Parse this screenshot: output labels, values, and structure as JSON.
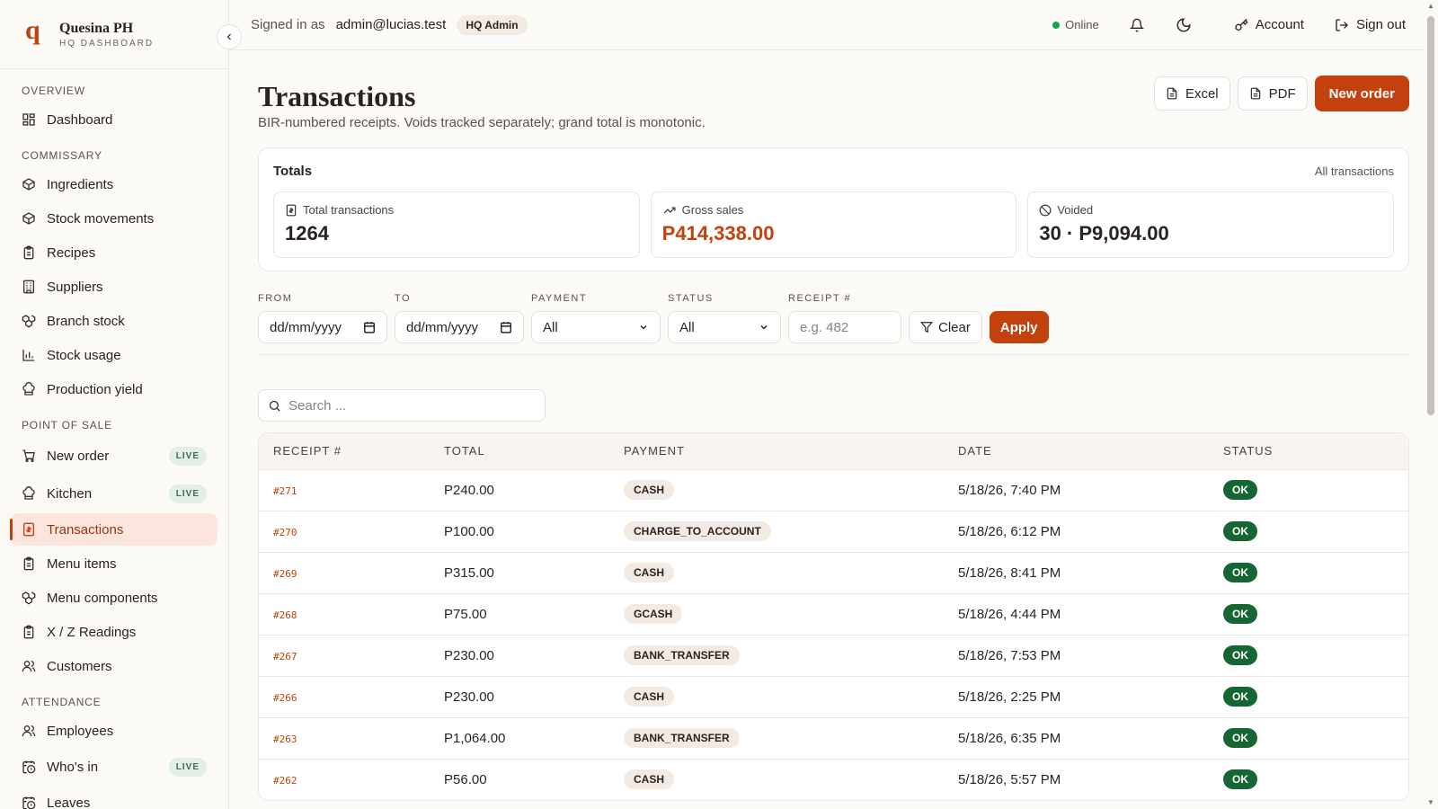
{
  "brand": {
    "logo": "q",
    "name": "Quesina PH",
    "subtitle": "HQ DASHBOARD"
  },
  "sidebar": {
    "sections": [
      {
        "title": "OVERVIEW",
        "items": [
          {
            "label": "Dashboard",
            "icon": "dashboard-icon"
          }
        ]
      },
      {
        "title": "COMMISSARY",
        "items": [
          {
            "label": "Ingredients",
            "icon": "box-icon"
          },
          {
            "label": "Stock movements",
            "icon": "box-icon"
          },
          {
            "label": "Recipes",
            "icon": "clipboard-icon"
          },
          {
            "label": "Suppliers",
            "icon": "building-icon"
          },
          {
            "label": "Branch stock",
            "icon": "boxes-icon"
          },
          {
            "label": "Stock usage",
            "icon": "bar-chart-icon"
          },
          {
            "label": "Production yield",
            "icon": "chef-hat-icon"
          }
        ]
      },
      {
        "title": "POINT OF SALE",
        "items": [
          {
            "label": "New order",
            "icon": "cart-icon",
            "badge": "LIVE"
          },
          {
            "label": "Kitchen",
            "icon": "chef-hat-icon",
            "badge": "LIVE"
          },
          {
            "label": "Transactions",
            "icon": "receipt-icon",
            "active": true
          },
          {
            "label": "Menu items",
            "icon": "clipboard-icon"
          },
          {
            "label": "Menu components",
            "icon": "boxes-icon"
          },
          {
            "label": "X / Z Readings",
            "icon": "clipboard-icon"
          },
          {
            "label": "Customers",
            "icon": "users-icon"
          }
        ]
      },
      {
        "title": "ATTENDANCE",
        "items": [
          {
            "label": "Employees",
            "icon": "users-icon"
          },
          {
            "label": "Who's in",
            "icon": "calendar-clock-icon",
            "badge": "LIVE"
          },
          {
            "label": "Leaves",
            "icon": "calendar-clock-icon"
          }
        ]
      }
    ]
  },
  "topbar": {
    "signed_in_label": "Signed in as",
    "email": "admin@lucias.test",
    "role": "HQ Admin",
    "status": "Online",
    "status_color": "#16a34a",
    "account_label": "Account",
    "signout_label": "Sign out"
  },
  "page": {
    "title": "Transactions",
    "subtitle": "BIR-numbered receipts. Voids tracked separately; grand total is monotonic.",
    "excel_label": "Excel",
    "pdf_label": "PDF",
    "new_order_label": "New order"
  },
  "totals": {
    "title": "Totals",
    "link": "All transactions",
    "total_transactions_label": "Total transactions",
    "total_transactions": "1264",
    "gross_sales_label": "Gross sales",
    "gross_sales": "P414,338.00",
    "voided_label": "Voided",
    "voided": "30 · P9,094.00"
  },
  "filters": {
    "from_label": "FROM",
    "from_value": "dd/mm/yyyy",
    "to_label": "TO",
    "to_value": "dd/mm/yyyy",
    "payment_label": "PAYMENT",
    "payment_value": "All",
    "status_label": "STATUS",
    "status_value": "All",
    "receipt_label": "RECEIPT #",
    "receipt_placeholder": "e.g. 482",
    "clear_label": "Clear",
    "apply_label": "Apply"
  },
  "search": {
    "placeholder": "Search ..."
  },
  "table": {
    "columns": [
      "RECEIPT #",
      "TOTAL",
      "PAYMENT",
      "DATE",
      "STATUS"
    ],
    "rows": [
      {
        "receipt": "#271",
        "total": "P240.00",
        "payment": "CASH",
        "date": "5/18/26, 7:40 PM",
        "status": "OK"
      },
      {
        "receipt": "#270",
        "total": "P100.00",
        "payment": "CHARGE_TO_ACCOUNT",
        "date": "5/18/26, 6:12 PM",
        "status": "OK"
      },
      {
        "receipt": "#269",
        "total": "P315.00",
        "payment": "CASH",
        "date": "5/18/26, 8:41 PM",
        "status": "OK"
      },
      {
        "receipt": "#268",
        "total": "P75.00",
        "payment": "GCASH",
        "date": "5/18/26, 4:44 PM",
        "status": "OK"
      },
      {
        "receipt": "#267",
        "total": "P230.00",
        "payment": "BANK_TRANSFER",
        "date": "5/18/26, 7:53 PM",
        "status": "OK"
      },
      {
        "receipt": "#266",
        "total": "P230.00",
        "payment": "CASH",
        "date": "5/18/26, 2:25 PM",
        "status": "OK"
      },
      {
        "receipt": "#263",
        "total": "P1,064.00",
        "payment": "BANK_TRANSFER",
        "date": "5/18/26, 6:35 PM",
        "status": "OK"
      },
      {
        "receipt": "#262",
        "total": "P56.00",
        "payment": "CASH",
        "date": "5/18/26, 5:57 PM",
        "status": "OK"
      }
    ]
  },
  "colors": {
    "accent": "#c2410c",
    "ok": "#166534",
    "live_bg": "#e3efe6"
  }
}
